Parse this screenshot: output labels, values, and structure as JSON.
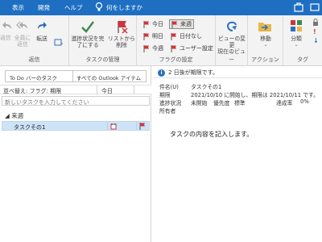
{
  "menubar": {
    "items": [
      "表示",
      "開発",
      "ヘルプ"
    ],
    "tellme": "何をしますか"
  },
  "ribbon": {
    "respond": {
      "label": "返信",
      "buttons": [
        "返信",
        "全員に返信",
        "転送"
      ]
    },
    "manage": {
      "label": "タスクの管理",
      "complete": "進捗状況を完了にする",
      "remove": "リストから削除"
    },
    "followup": {
      "label": "フラグの設定",
      "today": "今日",
      "tomorrow": "明日",
      "thisweek": "今週",
      "nextweek": "来週",
      "nodate": "日付なし",
      "custom": "ユーザー設定"
    },
    "current_view": {
      "label": "現在のビュー",
      "change": "ビューの変更"
    },
    "actions": {
      "label": "アクション",
      "move": "移動"
    },
    "tags": {
      "label": "タグ",
      "categorize": "分類"
    }
  },
  "taskpane": {
    "search_scope": "To Do バーのタスク",
    "search_all": "すべての Outlook アイテム",
    "sort_label": "並べ替え: フラグ: 期限",
    "sort_value": "今日",
    "new_task_placeholder": "新しいタスクを入力してください",
    "group_name": "来週",
    "tasks": [
      {
        "name": "タスクその1"
      }
    ]
  },
  "reading": {
    "info_text": "2 日後が期限です。",
    "subject_label": "件名(U)",
    "subject_value": "タスクその1",
    "due_label": "期限",
    "due_value": "2021/10/10 に開始し、期限は 2021/10/11 です。",
    "status_label": "進捗状況",
    "status_value": "未開始",
    "priority_label": "優先度",
    "priority_value": "標準",
    "complete_label": "達成率",
    "complete_value": "0%",
    "owner_label": "所有者",
    "body": "タスクの内容を記入します。"
  },
  "colors": {
    "menubar": "#1e6fc2",
    "selected_row": "#cde3f7",
    "flag_red": "#d13438",
    "accent_blue": "#2b6fbd"
  }
}
